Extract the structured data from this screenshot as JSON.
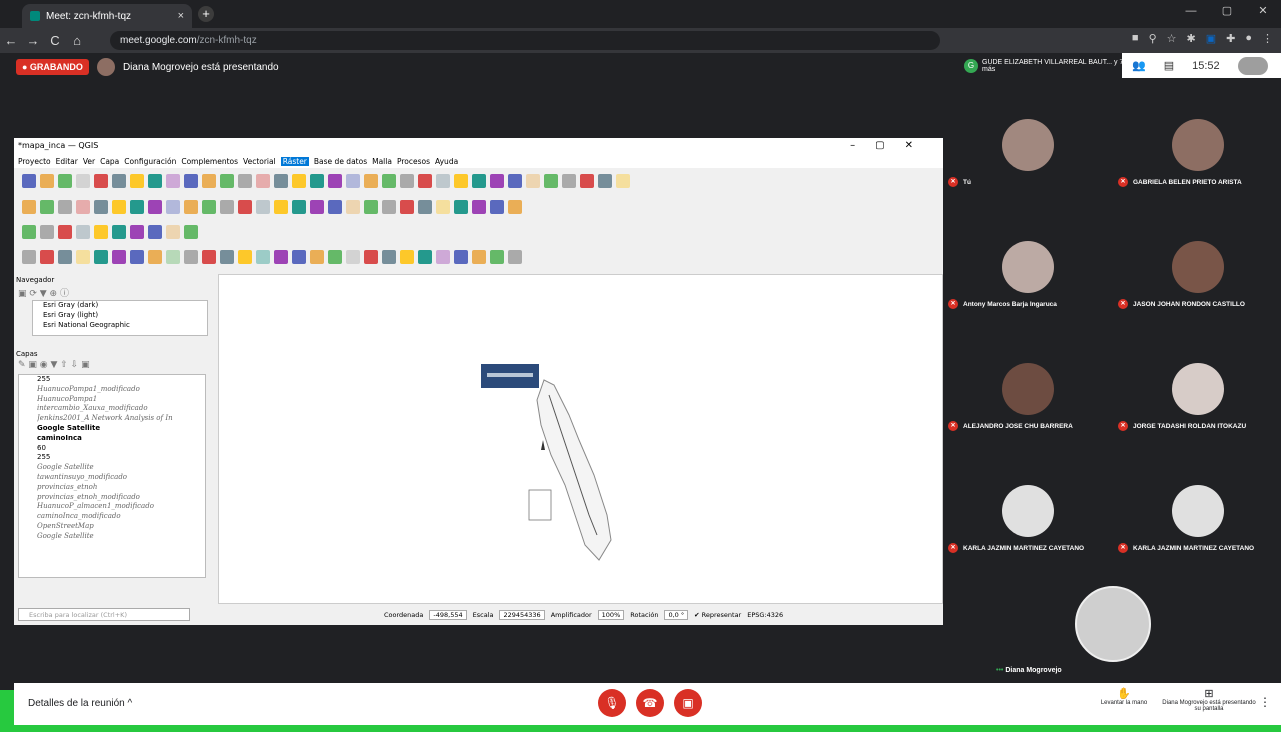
{
  "browser": {
    "tab_title": "Meet: zcn-kfmh-tqz",
    "url_domain": "meet.google.com",
    "url_path": "/zcn-kfmh-tqz",
    "tab_close": "×",
    "new_tab": "+",
    "win_min": "—",
    "win_max": "▢",
    "win_close": "✕",
    "back": "←",
    "forward": "→",
    "reload": "C",
    "home": "⌂",
    "lock": "🔒"
  },
  "meet": {
    "recording": "● GRABANDO",
    "presenting": "Diana Mogrovejo está presentando",
    "host_initial": "G",
    "host_name": "GUDE ELIZABETH VILLARREAL BAUT... y 7 más",
    "time": "15:52",
    "meeting_details": "Detalles de la reunión",
    "raise_hand": "Levantar la mano",
    "presenting_notice": "Diana Mogrovejo está presentando su pantalla",
    "more": "⋮"
  },
  "qgis": {
    "title": "*mapa_inca — QGIS",
    "menu": [
      "Proyecto",
      "Editar",
      "Ver",
      "Capa",
      "Configuración",
      "Complementos",
      "Vectorial",
      "Ráster",
      "Base de datos",
      "Malla",
      "Procesos",
      "Ayuda"
    ],
    "browser_panel": "Navegador",
    "browser_items": [
      "Esri Gray (dark)",
      "Esri Gray (light)",
      "Esri National Geographic"
    ],
    "layers_panel": "Capas",
    "layers": [
      {
        "t": "255",
        "c": ""
      },
      {
        "t": "HuanucoPampa1_modificado",
        "c": "it"
      },
      {
        "t": "HuanucoPampa1",
        "c": "it"
      },
      {
        "t": "intercambio_Xauxa_modificado",
        "c": "it"
      },
      {
        "t": "Jenkins2001_A Network Analysis of In",
        "c": "it"
      },
      {
        "t": "Google Satellite",
        "c": "bd"
      },
      {
        "t": "caminoInca",
        "c": "bd"
      },
      {
        "t": "60",
        "c": ""
      },
      {
        "t": "255",
        "c": ""
      },
      {
        "t": "Google Satellite",
        "c": "it"
      },
      {
        "t": "tawantinsuyo_modificado",
        "c": "it"
      },
      {
        "t": "provincias_etnoh",
        "c": "it"
      },
      {
        "t": "provincias_etnoh_modificado",
        "c": "it"
      },
      {
        "t": "HuanucoP_almacen1_modificado",
        "c": "it"
      },
      {
        "t": "caminoInca_modificado",
        "c": "it"
      },
      {
        "t": "OpenStreetMap",
        "c": "it"
      },
      {
        "t": "Google Satellite",
        "c": "it"
      }
    ],
    "search_placeholder": "Escriba para localizar (Ctrl+K)",
    "coord_label": "Coordenada",
    "coord": "-498,554",
    "scale_label": "Escala",
    "scale": "229454336",
    "magnifier_label": "Amplificador",
    "magnifier": "100%",
    "rotation_label": "Rotación",
    "rotation": "0,0 °",
    "render": "Representar",
    "crs": "EPSG:4326"
  },
  "participants": [
    "Tú",
    "GABRIELA BELEN PRIETO ARISTA",
    "Antony Marcos Barja Ingaruca",
    "JASON JOHAN RONDON CASTILLO",
    "ALEJANDRO JOSE CHU BARRERA",
    "JORGE TADASHI ROLDAN ITOKAZU",
    "KARLA JAZMIN MARTINEZ CAYETANO",
    "KARLA JAZMIN MARTINEZ CAYETANO"
  ],
  "self_name": "Diana Mogrovejo"
}
